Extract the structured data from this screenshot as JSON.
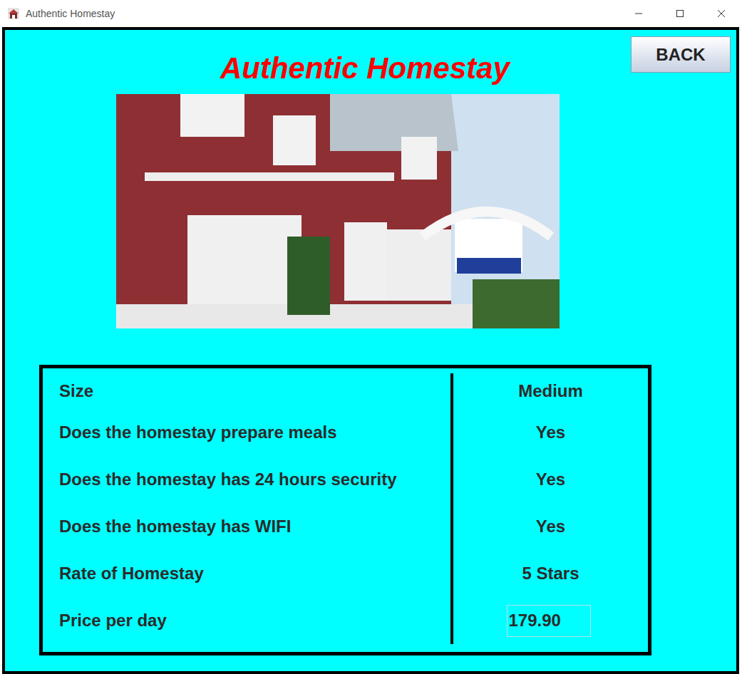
{
  "window": {
    "title": "Authentic Homestay"
  },
  "header": {
    "title": "Authentic Homestay",
    "back_button": "BACK"
  },
  "details": {
    "rows": [
      {
        "label": "Size",
        "value": "Medium",
        "kind": "text"
      },
      {
        "label": "Does the homestay prepare meals",
        "value": "Yes",
        "kind": "text"
      },
      {
        "label": "Does the homestay has 24 hours security",
        "value": "Yes",
        "kind": "text"
      },
      {
        "label": "Does the homestay has WIFI",
        "value": "Yes",
        "kind": "text"
      },
      {
        "label": "Rate of Homestay",
        "value": "5 Stars",
        "kind": "text"
      },
      {
        "label": "Price per day",
        "value": "179.90",
        "kind": "field"
      }
    ]
  }
}
